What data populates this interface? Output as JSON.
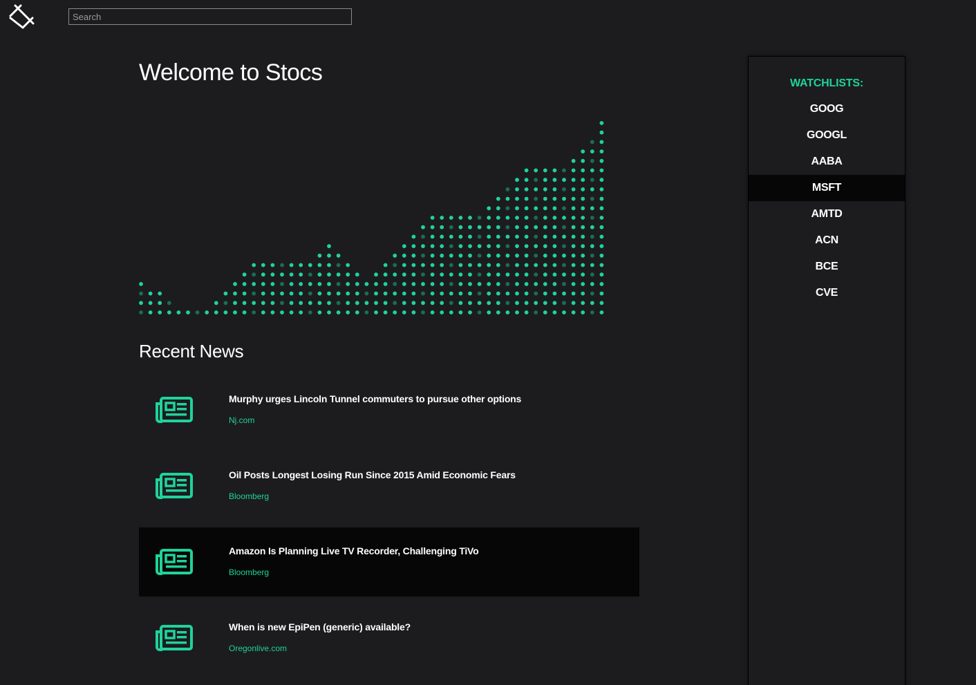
{
  "header": {
    "logo_icon": "stocs-logo-icon",
    "search": {
      "placeholder": "Search",
      "value": ""
    }
  },
  "main": {
    "title": "Welcome to Stocs",
    "news_heading": "Recent News"
  },
  "chart_data": {
    "type": "dot-matrix column",
    "values": [
      3,
      2,
      2,
      1,
      0,
      0,
      0,
      0,
      1,
      2,
      3,
      4,
      5,
      5,
      5,
      5,
      5,
      5,
      5,
      6,
      7,
      6,
      5,
      4,
      3,
      4,
      5,
      6,
      7,
      8,
      9,
      10,
      10,
      10,
      10,
      10,
      10,
      11,
      12,
      13,
      14,
      15,
      15,
      15,
      15,
      15,
      16,
      17,
      18,
      20
    ],
    "colors": {
      "bright": "#1fd39a",
      "dim": "#1a6e54"
    }
  },
  "news": [
    {
      "title": "Murphy urges Lincoln Tunnel commuters to pursue other options",
      "source": "Nj.com",
      "icon": "newspaper-icon"
    },
    {
      "title": "Oil Posts Longest Losing Run Since 2015 Amid Economic Fears",
      "source": "Bloomberg",
      "icon": "newspaper-icon"
    },
    {
      "title": "Amazon Is Planning Live TV Recorder, Challenging TiVo",
      "source": "Bloomberg",
      "icon": "newspaper-icon",
      "selected": true
    },
    {
      "title": "When is new EpiPen (generic) available?",
      "source": "Oregonlive.com",
      "icon": "newspaper-icon"
    }
  ],
  "watchlists": {
    "title": "WATCHLISTS:",
    "items": [
      {
        "label": "GOOG"
      },
      {
        "label": "GOOGL"
      },
      {
        "label": "AABA"
      },
      {
        "label": "MSFT",
        "selected": true
      },
      {
        "label": "AMTD"
      },
      {
        "label": "ACN"
      },
      {
        "label": "BCE"
      },
      {
        "label": "CVE"
      }
    ]
  },
  "colors": {
    "accent": "#1fd39a",
    "background": "#1c1c1e",
    "selected": "#060606"
  }
}
